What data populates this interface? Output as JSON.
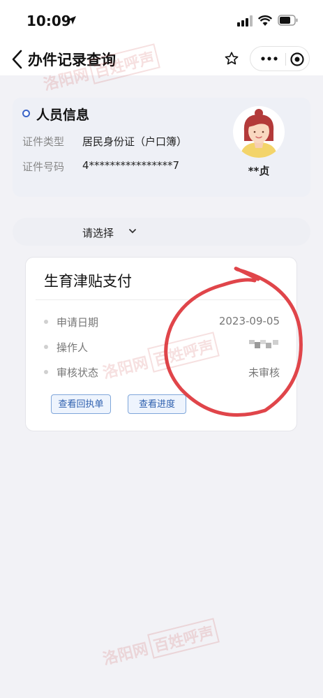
{
  "status_bar": {
    "time": "10:09"
  },
  "nav": {
    "title": "办件记录查询"
  },
  "person": {
    "section_title": "人员信息",
    "id_type_label": "证件类型",
    "id_type_value": "居民身份证（户口簿）",
    "id_no_label": "证件号码",
    "id_no_value": "4****************7",
    "name": "**贞"
  },
  "select": {
    "placeholder": "请选择"
  },
  "record": {
    "title": "生育津贴支付",
    "apply_date_label": "申请日期",
    "apply_date_value": "2023-09-05",
    "operator_label": "操作人",
    "status_label": "审核状态",
    "status_value": "未审核",
    "receipt_button": "查看回执单",
    "progress_button": "查看进度"
  },
  "watermark": {
    "text1": "洛阳网",
    "text2": "百姓呼声"
  },
  "colors": {
    "accent": "#3b64c8",
    "button_border": "#7fa6da",
    "circle": "#e0454a"
  }
}
